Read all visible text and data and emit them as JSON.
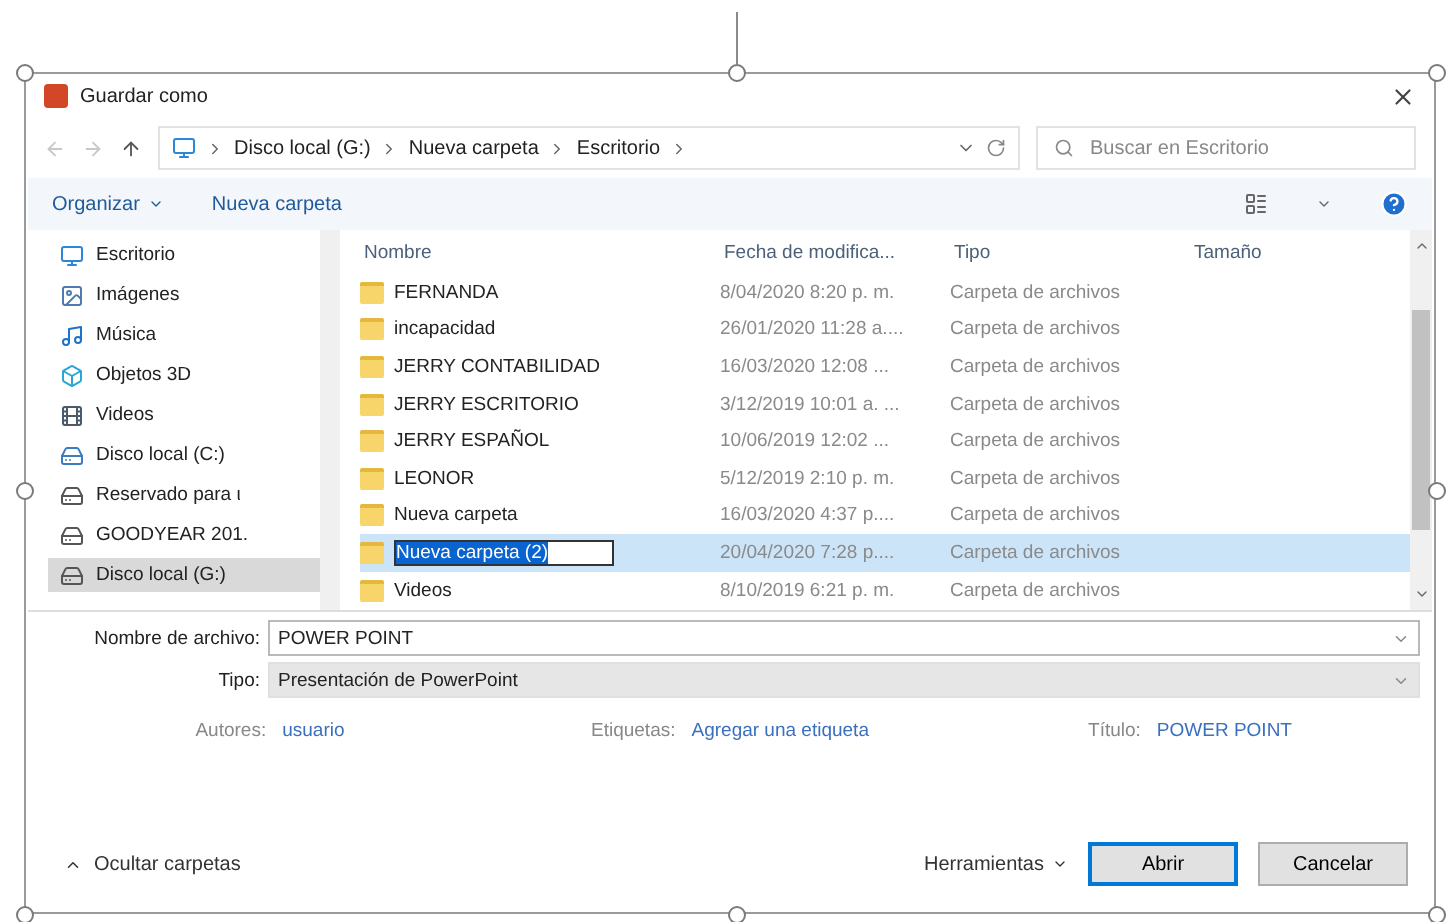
{
  "window": {
    "title": "Guardar como"
  },
  "address_bar": {
    "path": [
      {
        "label": "Disco local (G:)"
      },
      {
        "label": "Nueva carpeta"
      },
      {
        "label": "Escritorio"
      }
    ],
    "search": {
      "placeholder": "Buscar en Escritorio"
    }
  },
  "toolbar": {
    "organize": "Organizar",
    "new_folder": "Nueva carpeta"
  },
  "sidebar": {
    "items": [
      {
        "label": "Escritorio",
        "kind": "desktop",
        "selected": false
      },
      {
        "label": "Imágenes",
        "kind": "images",
        "selected": false
      },
      {
        "label": "Música",
        "kind": "music",
        "selected": false
      },
      {
        "label": "Objetos 3D",
        "kind": "cube",
        "selected": false
      },
      {
        "label": "Videos",
        "kind": "video",
        "selected": false
      },
      {
        "label": "Disco local (C:)",
        "kind": "systemdrive",
        "selected": false
      },
      {
        "label": "Reservado para ι",
        "kind": "drive",
        "selected": false
      },
      {
        "label": "GOODYEAR 201.",
        "kind": "drive",
        "selected": false
      },
      {
        "label": "Disco local (G:)",
        "kind": "drive",
        "selected": true
      }
    ]
  },
  "table": {
    "columns": [
      "Nombre",
      "Fecha de modifica...",
      "Tipo",
      "Tamaño"
    ],
    "rows": [
      {
        "name": "FERNANDA",
        "date": "8/04/2020 8:20 p. m.",
        "type": "Carpeta de archivos",
        "selected": false,
        "editing": false
      },
      {
        "name": "incapacidad",
        "date": "26/01/2020 11:28 a....",
        "type": "Carpeta de archivos",
        "selected": false,
        "editing": false
      },
      {
        "name": "JERRY CONTABILIDAD",
        "date": "16/03/2020 12:08 ...",
        "type": "Carpeta de archivos",
        "selected": false,
        "editing": false
      },
      {
        "name": "JERRY ESCRITORIO",
        "date": "3/12/2019 10:01 a. ...",
        "type": "Carpeta de archivos",
        "selected": false,
        "editing": false
      },
      {
        "name": "JERRY ESPAÑOL",
        "date": "10/06/2019 12:02 ...",
        "type": "Carpeta de archivos",
        "selected": false,
        "editing": false
      },
      {
        "name": "LEONOR",
        "date": "5/12/2019 2:10 p. m.",
        "type": "Carpeta de archivos",
        "selected": false,
        "editing": false
      },
      {
        "name": "Nueva carpeta",
        "date": "16/03/2020 4:37 p....",
        "type": "Carpeta de archivos",
        "selected": false,
        "editing": false
      },
      {
        "name": "Nueva carpeta (2)",
        "date": "20/04/2020 7:28 p....",
        "type": "Carpeta de archivos",
        "selected": true,
        "editing": true
      },
      {
        "name": "Videos",
        "date": "8/10/2019 6:21 p. m.",
        "type": "Carpeta de archivos",
        "selected": false,
        "editing": false
      }
    ]
  },
  "filename": {
    "label": "Nombre de archivo:",
    "value": "POWER POINT"
  },
  "filetype": {
    "label": "Tipo:",
    "value": "Presentación de PowerPoint"
  },
  "metadata": [
    {
      "label": "Autores:",
      "value": "usuario"
    },
    {
      "label": "Etiquetas:",
      "value": "Agregar una etiqueta"
    },
    {
      "label": "Título:",
      "value": "POWER POINT"
    }
  ],
  "footer": {
    "hide_folders": "Ocultar carpetas",
    "tools": "Herramientas",
    "buttons": [
      {
        "label": "Abrir",
        "default": true
      },
      {
        "label": "Cancelar",
        "default": false
      }
    ]
  }
}
